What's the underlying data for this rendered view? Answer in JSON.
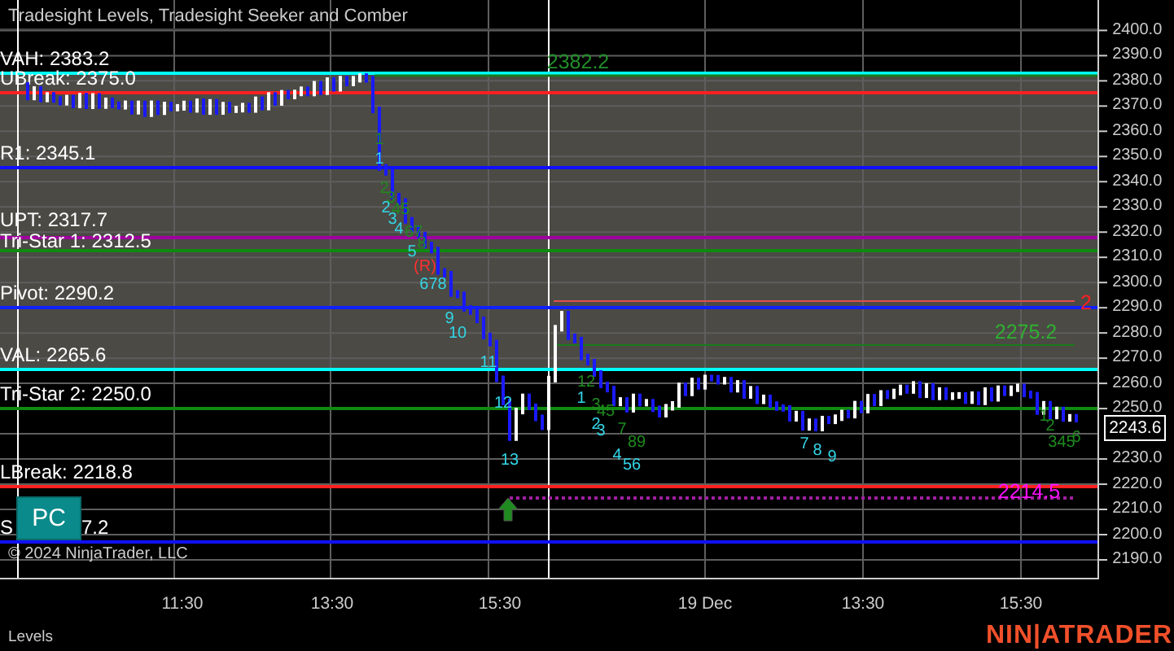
{
  "title": "Tradesight Levels, Tradesight Seeker and Comber",
  "levels": [
    {
      "label": "VAH: 2383.2",
      "color": "#00ffff"
    },
    {
      "label": "UBreak: 2375.0",
      "color": "#ff2020"
    },
    {
      "label": "R1: 2345.1",
      "color": "#1010ff"
    },
    {
      "label": "UPT: 2317.7",
      "color": "#a000a0"
    },
    {
      "label": "Tri-Star 1: 2312.5",
      "color": "#108a10"
    },
    {
      "label": "Pivot: 2290.2",
      "color": "#1020ff"
    },
    {
      "label": "VAL: 2265.6",
      "color": "#00ffff"
    },
    {
      "label": "Tri-Star 2: 2250.0",
      "color": "#108a10"
    },
    {
      "label": "LBreak: 2218.8",
      "color": "#ff2020"
    },
    {
      "label": "S",
      "tail": "7.2",
      "color": "#1010ff"
    }
  ],
  "pc_button": "PC",
  "annotations": [
    {
      "text": "2382.2",
      "color": "#22902a"
    },
    {
      "text": "2",
      "color": "#ff2020"
    },
    {
      "text": "2275.2",
      "color": "#30b030"
    },
    {
      "text": "2214.5",
      "color": "#ff10ff"
    }
  ],
  "markers": [
    {
      "text": "1",
      "color": "#1f8a1f"
    },
    {
      "text": "1",
      "color": "#33d6e6"
    },
    {
      "text": "2",
      "color": "#1f8a1f"
    },
    {
      "text": "3",
      "color": "#1f8a1f"
    },
    {
      "text": "2",
      "color": "#33d6e6"
    },
    {
      "text": "45",
      "color": "#1f8a1f"
    },
    {
      "text": "3",
      "color": "#33d6e6"
    },
    {
      "text": "4",
      "color": "#33d6e6"
    },
    {
      "text": "67",
      "color": "#1f8a1f"
    },
    {
      "text": "8",
      "color": "#1f8a1f"
    },
    {
      "text": "5",
      "color": "#33d6e6"
    },
    {
      "text": "(R)",
      "color": "#ff3030"
    },
    {
      "text": "678",
      "color": "#33d6e6"
    },
    {
      "text": "9",
      "color": "#33d6e6"
    },
    {
      "text": "10",
      "color": "#33d6e6"
    },
    {
      "text": "11",
      "color": "#33d6e6"
    },
    {
      "text": "12",
      "color": "#33d6e6"
    },
    {
      "text": "13",
      "color": "#33d6e6"
    },
    {
      "text": "12",
      "color": "#1f8a1f"
    },
    {
      "text": "1",
      "color": "#33d6e6"
    },
    {
      "text": "3",
      "color": "#1f8a1f"
    },
    {
      "text": "45",
      "color": "#1f8a1f"
    },
    {
      "text": "2",
      "color": "#33d6e6"
    },
    {
      "text": "3",
      "color": "#33d6e6"
    },
    {
      "text": "7",
      "color": "#1f8a1f"
    },
    {
      "text": "89",
      "color": "#1f8a1f"
    },
    {
      "text": "4",
      "color": "#33d6e6"
    },
    {
      "text": "56",
      "color": "#33d6e6"
    },
    {
      "text": "7",
      "color": "#33d6e6"
    },
    {
      "text": "8",
      "color": "#33d6e6"
    },
    {
      "text": "9",
      "color": "#33d6e6"
    },
    {
      "text": "1",
      "color": "#1f8a1f"
    },
    {
      "text": "2",
      "color": "#1f8a1f"
    },
    {
      "text": "345",
      "color": "#1f8a1f"
    },
    {
      "text": "6",
      "color": "#1f8a1f"
    }
  ],
  "y_axis": [
    "2400.0",
    "2390.0",
    "2380.0",
    "2370.0",
    "2360.0",
    "2350.0",
    "2340.0",
    "2330.0",
    "2320.0",
    "2310.0",
    "2300.0",
    "2290.0",
    "2280.0",
    "2270.0",
    "2260.0",
    "2250.0",
    "2230.0",
    "2220.0",
    "2210.0",
    "2200.0",
    "2190.0"
  ],
  "price_tag": "2243.6",
  "x_axis": [
    "11:30",
    "13:30",
    "15:30",
    "19 Dec",
    "13:30",
    "15:30"
  ],
  "copyright": "© 2024 NinjaTrader, LLC",
  "footer": {
    "panel": "Levels",
    "logo": "NIN|ATRADER"
  }
}
